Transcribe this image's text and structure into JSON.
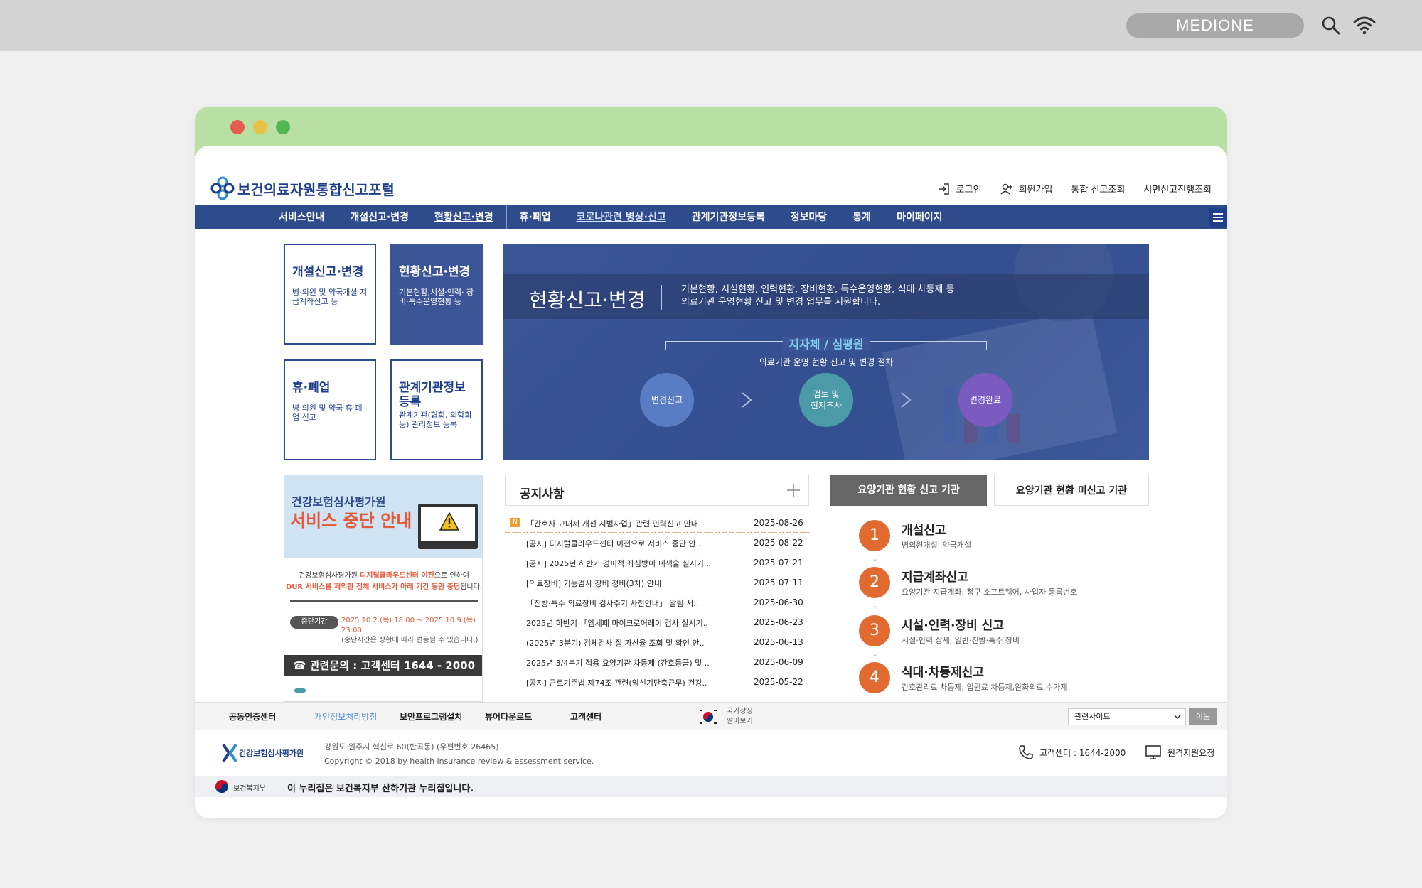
{
  "os": {
    "pill_label": "MEDIONE"
  },
  "site": {
    "logo_text": "보건의료자원통합신고포털",
    "top_links": [
      {
        "label": "로그인",
        "icon": "login-icon"
      },
      {
        "label": "회원가입",
        "icon": "user-add-icon"
      },
      {
        "label": "통합 신고조회"
      },
      {
        "label": "서면신고진행조회"
      }
    ]
  },
  "nav": {
    "items": [
      "서비스안내",
      "개설신고·변경",
      "현황신고·변경",
      "휴·폐업",
      "코로나관련 병상·신고",
      "관계기관정보등록",
      "정보마당",
      "통계",
      "마이페이지"
    ]
  },
  "tiles": [
    {
      "title": "개설신고·변경",
      "desc": "병·의원 및 약국개설 지급계좌신고 등"
    },
    {
      "title": "현황신고·변경",
      "desc": "기본현황,시설·인력· 장비·특수운영현황 등"
    },
    {
      "title": "휴·폐업",
      "desc": "병·의원 및 약국 휴·폐업 신고"
    },
    {
      "title": "관계기관정보 등록",
      "desc": "관계기관(협회, 의학회 등) 관리정보 등록"
    }
  ],
  "hero": {
    "title": "현황신고·변경",
    "desc_line1": "기본현황, 시설현황, 인력현황, 장비현황, 특수운영현황, 식대·차등제 등",
    "desc_line2": "의료기관 운영현황 신고 및 변경 업무를 지원합니다.",
    "sub_title": "지자체 / 심평원",
    "sub_desc": "의료기관 운영 현황 신고 및 변경 절차",
    "steps": [
      "변경신고",
      "검토 및 현지조사",
      "변경완료"
    ]
  },
  "promo": {
    "h1": "건강보험심사평가원",
    "h2": "서비스 중단 안내",
    "text_a": "건강보험심사평가원 ",
    "text_b": "디지털클라우드센터 이전",
    "text_c": "으로 인하여",
    "text_d": "DUR 서비스를 제외한 ",
    "text_e": "전체 서비스가 아래 기간 동안 중단",
    "text_f": "됩니다.",
    "badge": "중단기간",
    "period": "2025.10.2.(목) 18:00 ~ 2025.10.9.(목) 23:00",
    "period_note": "(중단시간은 상황에 따라 변동될 수 있습니다.)",
    "contact": "관련문의 : 고객센터 1644 - 2000"
  },
  "notices": {
    "title": "공지사항",
    "new_badge": "N",
    "rows": [
      {
        "text": "「간호사 교대제 개선 시범사업」관련 인력신고 안내",
        "date": "2025-08-26"
      },
      {
        "text": "[공지] 디지털클라우드센터 이전으로 서비스 중단 안..",
        "date": "2025-08-22"
      },
      {
        "text": "[공지] 2025년 하반기 경피적 좌심방이 폐색술 실시기..",
        "date": "2025-07-21"
      },
      {
        "text": "[의료장비] 기능검사 장비 정비(3차) 안내",
        "date": "2025-07-11"
      },
      {
        "text": "「진방·특수 의료장비 검사주기 사전안내」 알림 서..",
        "date": "2025-06-30"
      },
      {
        "text": "2025년 하반기 「엠세페 마이크로어레이 검사 실시기..",
        "date": "2025-06-23"
      },
      {
        "text": "(2025년 3분기) 검체검사 질 가산율 조회 및 확인 안..",
        "date": "2025-06-13"
      },
      {
        "text": "2025년 3/4분기 적용 요양기관 차등제 (간호등급) 및 ..",
        "date": "2025-06-09"
      },
      {
        "text": "[공지] 근로기준법 제74조 관련(임신기단축근무) 건강..",
        "date": "2025-05-22"
      }
    ]
  },
  "tabs": {
    "active": "요양기관 현황 신고 기관",
    "inactive": "요양기관 현황 미신고 기관"
  },
  "procedures": [
    {
      "num": "1",
      "title": "개설신고",
      "desc": "병의원개설, 약국개설"
    },
    {
      "num": "2",
      "title": "지급계좌신고",
      "desc": "요양기관 지급계좌, 청구 소프트웨어, 사업자 등록번호"
    },
    {
      "num": "3",
      "title": "시설·인력·장비 신고",
      "desc": "시설·인력 상세, 일반·진방·특수 장비"
    },
    {
      "num": "4",
      "title": "식대·차등제신고",
      "desc": "간호관리료 차등제, 입원료 차등제,완화의료 수가제"
    }
  ],
  "footer": {
    "links": [
      "공동인증센터",
      "개인정보처리방침",
      "보안프로그램설치",
      "뷰어다운로드",
      "고객센터"
    ],
    "flag_text_1": "국가상징",
    "flag_text_2": "알아보기",
    "related_label": "관련사이트",
    "move_label": "이동",
    "org_name": "건강보험심사평가원",
    "address": "강원도 원주시 혁신로 60(반곡동) (우편번호 26465)",
    "copyright": "Copyright © 2018 by health insurance review & assessment service.",
    "cs_label": "고객센터 : 1644-2000",
    "remote_label": "원격지원요청",
    "gov_name": "보건복지부",
    "gov_text": "이 누리집은 보건복지부 산하기관 누리집입니다."
  },
  "colors": {
    "nav_bg": "#2e4b8c",
    "accent_orange": "#e06a30",
    "titlebar_green": "#b8e0a2"
  }
}
